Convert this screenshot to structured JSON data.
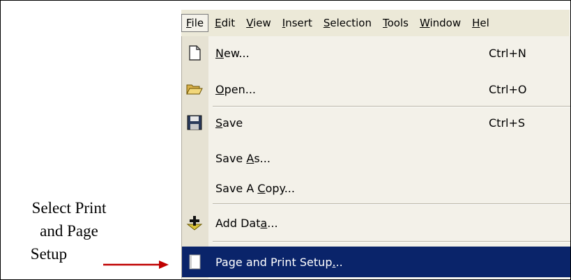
{
  "annotation": {
    "lines": [
      "Select Print",
      "and Page",
      "Setup"
    ]
  },
  "menubar": {
    "items": [
      {
        "label": "File",
        "mnemonic_index": 0,
        "active": true
      },
      {
        "label": "Edit",
        "mnemonic_index": 0
      },
      {
        "label": "View",
        "mnemonic_index": 0
      },
      {
        "label": "Insert",
        "mnemonic_index": 0
      },
      {
        "label": "Selection",
        "mnemonic_index": 0
      },
      {
        "label": "Tools",
        "mnemonic_index": 0
      },
      {
        "label": "Window",
        "mnemonic_index": 0
      },
      {
        "label": "Hel",
        "mnemonic_index": 0
      }
    ]
  },
  "file_menu": {
    "new": {
      "label": "New...",
      "mnemonic_index": 0,
      "shortcut": "Ctrl+N",
      "icon": "new-document-icon"
    },
    "open": {
      "label": "Open...",
      "mnemonic_index": 0,
      "shortcut": "Ctrl+O",
      "icon": "open-folder-icon"
    },
    "save": {
      "label": "Save",
      "mnemonic_index": 0,
      "shortcut": "Ctrl+S",
      "icon": "save-disk-icon"
    },
    "save_as": {
      "label": "Save As...",
      "mnemonic_index": 5
    },
    "save_copy": {
      "label": "Save A Copy...",
      "mnemonic_index": 7
    },
    "add_data": {
      "label": "Add Data...",
      "mnemonic_index": 7,
      "icon": "add-data-icon"
    },
    "page_print_setup": {
      "label": "Page and Print Setup...",
      "mnemonic_index": 20,
      "icon": "page-setup-icon",
      "highlighted": true
    }
  },
  "colors": {
    "highlight_bg": "#0a246a",
    "menu_bg": "#f3f1e9",
    "gutter_bg": "#e6e2d3",
    "arrow": "#c00000"
  }
}
